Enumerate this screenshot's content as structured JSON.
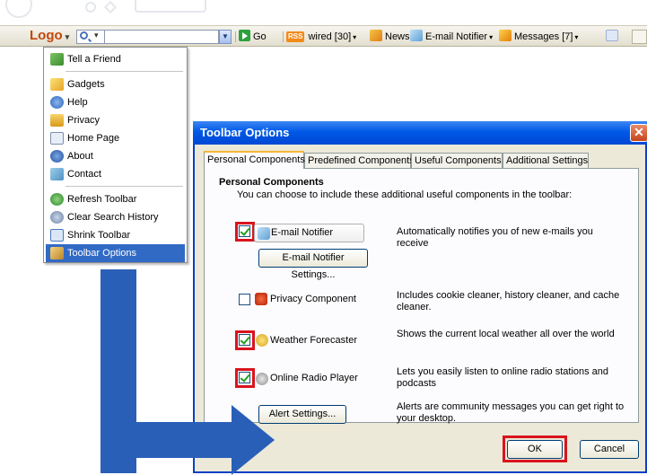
{
  "toolbar": {
    "logo_label": "Logo",
    "go_label": "Go",
    "rss_badge": "RSS",
    "rss_label": "wired [30]",
    "news_label": "News",
    "email_label": "E-mail Notifier",
    "messages_label": "Messages [7]"
  },
  "menu": {
    "items": [
      {
        "label": "Tell a Friend",
        "icon": "people-icon"
      },
      {
        "label": "Gadgets",
        "icon": "gadgets-icon"
      },
      {
        "label": "Help",
        "icon": "help-icon"
      },
      {
        "label": "Privacy",
        "icon": "lock-icon"
      },
      {
        "label": "Home Page",
        "icon": "home-icon"
      },
      {
        "label": "About",
        "icon": "info-icon"
      },
      {
        "label": "Contact",
        "icon": "mail-icon"
      },
      {
        "label": "Refresh Toolbar",
        "icon": "refresh-icon"
      },
      {
        "label": "Clear Search History",
        "icon": "clear-icon"
      },
      {
        "label": "Shrink Toolbar",
        "icon": "shrink-icon"
      },
      {
        "label": "Toolbar Options",
        "icon": "wrench-icon",
        "selected": true
      }
    ]
  },
  "dialog": {
    "title": "Toolbar Options",
    "close_glyph": "✕",
    "tabs": [
      "Personal Components",
      "Predefined Components",
      "Useful Components",
      "Additional Settings"
    ],
    "active_tab": "Personal Components",
    "section_title": "Personal Components",
    "section_desc": "You can choose to include these additional useful components in the toolbar:",
    "components": [
      {
        "name": "E-mail Notifier",
        "checked": true,
        "highlighted": true,
        "desc": "Automatically notifies you of new e-mails you receive",
        "button": "E-mail Notifier Settings..."
      },
      {
        "name": "Privacy Component",
        "checked": false,
        "highlighted": false,
        "desc": "Includes cookie cleaner, history cleaner, and cache cleaner."
      },
      {
        "name": "Weather Forecaster",
        "checked": true,
        "highlighted": true,
        "desc": "Shows the current local weather all over the world"
      },
      {
        "name": "Online Radio Player",
        "checked": true,
        "highlighted": true,
        "desc": "Lets you easily listen to online radio stations and podcasts"
      }
    ],
    "alert_button": "Alert Settings...",
    "alert_desc": "Alerts are community messages you can get right to your desktop.",
    "ok_label": "OK",
    "cancel_label": "Cancel"
  },
  "colors": {
    "menu_selection": "#316ac5",
    "titlebar": "#0058e6",
    "highlight_border": "#d9141d",
    "arrow": "#2a5fb8",
    "logo_text": "#c4470a"
  }
}
